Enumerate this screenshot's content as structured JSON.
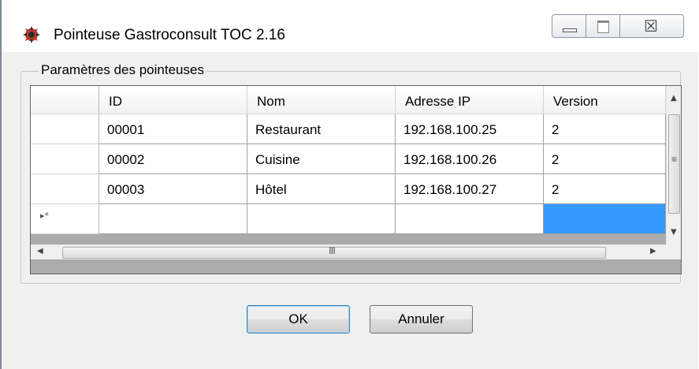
{
  "window": {
    "title": "Pointeuse Gastroconsult TOC 2.16",
    "icon": "app-logo-icon"
  },
  "caption_buttons": {
    "minimize": "minimize-icon",
    "maximize": "maximize-icon",
    "close_glyph": "☒"
  },
  "group": {
    "label": "Paramètres des pointeuses"
  },
  "grid": {
    "columns": [
      "ID",
      "Nom",
      "Adresse IP",
      "Version"
    ],
    "rows": [
      [
        "00001",
        "Restaurant",
        "192.168.100.25",
        "2"
      ],
      [
        "00002",
        "Cuisine",
        "192.168.100.26",
        "2"
      ],
      [
        "00003",
        "Hôtel",
        "192.168.100.27",
        "2"
      ]
    ],
    "new_row_marker": "▸*",
    "selected_cell": "new-row-version"
  },
  "scrollbars": {
    "hgrip": "III",
    "vgrip": "≡"
  },
  "buttons": {
    "ok": "OK",
    "cancel": "Annuler"
  },
  "colors": {
    "selection": "#3399ff",
    "window_bg": "#f0f0f0"
  }
}
